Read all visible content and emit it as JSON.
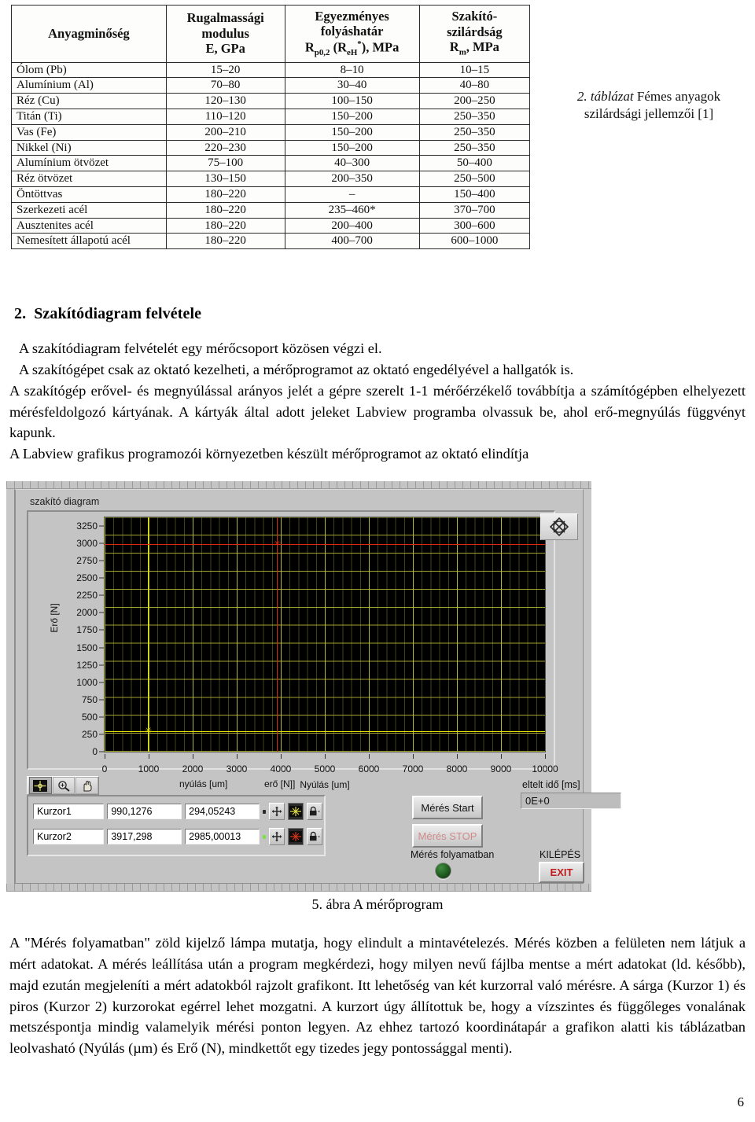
{
  "table": {
    "caption_prefix": "2. táblázat",
    "caption_rest": " Fémes anyagok",
    "caption_line2": "szilárdsági jellemzői [1]",
    "headers": [
      {
        "line1": "Anyagminőség",
        "line2": "",
        "line3": ""
      },
      {
        "line1": "Rugalmassági",
        "line2": "modulus",
        "line3": "E, GPa"
      },
      {
        "line1": "Egyezményes",
        "line2": "folyáshatár",
        "line3": "Rp0,2 (ReH*), MPa"
      },
      {
        "line1": "Szakító-",
        "line2": "szilárdság",
        "line3": "Rm, MPa"
      }
    ],
    "rows": [
      {
        "material": "Ólom (Pb)",
        "e": "15–20",
        "rp": "8–10",
        "rm": "10–15"
      },
      {
        "material": "Alumínium (Al)",
        "e": "70–80",
        "rp": "30–40",
        "rm": "40–80"
      },
      {
        "material": "Réz (Cu)",
        "e": "120–130",
        "rp": "100–150",
        "rm": "200–250"
      },
      {
        "material": "Titán (Ti)",
        "e": "110–120",
        "rp": "150–200",
        "rm": "250–350"
      },
      {
        "material": "Vas (Fe)",
        "e": "200–210",
        "rp": "150–200",
        "rm": "250–350"
      },
      {
        "material": "Nikkel (Ni)",
        "e": "220–230",
        "rp": "150–200",
        "rm": "250–350"
      },
      {
        "material": "Alumínium ötvözet",
        "e": "75–100",
        "rp": "40–300",
        "rm": "50–400"
      },
      {
        "material": "Réz ötvözet",
        "e": "130–150",
        "rp": "200–350",
        "rm": "250–500"
      },
      {
        "material": "Öntöttvas",
        "e": "180–220",
        "rp": "–",
        "rm": "150–400"
      },
      {
        "material": "Szerkezeti acél",
        "e": "180–220",
        "rp": "235–460*",
        "rm": "370–700"
      },
      {
        "material": "Ausztenites acél",
        "e": "180–220",
        "rp": "200–400",
        "rm": "300–600"
      },
      {
        "material": "Nemesített állapotú acél",
        "e": "180–220",
        "rp": "400–700",
        "rm": "600–1000"
      }
    ]
  },
  "section": {
    "number": "2.",
    "title": "Szakítódiagram felvétele",
    "paragraphs": [
      "A szakítódiagram felvételét egy mérőcsoport közösen végzi el.",
      "A szakítógépet csak az oktató kezelheti, a mérőprogramot az oktató engedélyével a hallgatók is.",
      "A szakítógép erővel- és megnyúlással arányos jelét a gépre szerelt 1-1 mérőérzékelő továbbítja a számítógépben elhelyezett mérésfeldolgozó kártyának. A kártyák által adott jeleket Labview programba olvassuk be, ahol erő-megnyúlás függvényt kapunk.",
      "A Labview grafikus programozói környezetben készült mérőprogramot az oktató elindítja"
    ]
  },
  "labview": {
    "graph_title": "szakító diagram",
    "palette_icon": "plot-palette-icon",
    "toolbar": [
      {
        "name": "cursor-move-tool",
        "glyph": "crosshair",
        "active": true
      },
      {
        "name": "zoom-tool",
        "glyph": "magnifier",
        "active": false
      },
      {
        "name": "pan-tool",
        "glyph": "hand",
        "active": false
      }
    ],
    "col_header_x": "nyúlás [um]",
    "col_header_y": "erő [N]]",
    "cursors": [
      {
        "name": "Kurzor1",
        "x": "990,1276",
        "y": "294,05243",
        "color": "#e6e600",
        "led": "#2a2a2a"
      },
      {
        "name": "Kurzor2",
        "x": "3917,298",
        "y": "2985,00013",
        "color": "#d92b12",
        "led": "#79e34a"
      }
    ],
    "start_button": "Mérés Start",
    "stop_button": "Mérés STOP",
    "running_label": "Mérés folyamatban",
    "elapsed_label": "eltelt idő [ms]",
    "elapsed_value": "0E+0",
    "exit_label": "KILÉPÉS",
    "exit_button": "EXIT",
    "colors": {
      "panel": "#c4c4c4",
      "plot_bg": "#000000",
      "grid": "#c9c93c",
      "cursor1": "#e6e600",
      "cursor2": "#d92b12",
      "exit_text": "#c01b1b",
      "led_green": "#2f7a2f"
    }
  },
  "chart_data": {
    "type": "line",
    "title": "szakító diagram",
    "xlabel": "Nyúlás  [um]",
    "ylabel": "Erő [N]",
    "xlim": [
      0,
      10000
    ],
    "ylim": [
      0,
      3375
    ],
    "xticks": [
      0,
      1000,
      2000,
      3000,
      4000,
      5000,
      6000,
      7000,
      8000,
      9000,
      10000
    ],
    "yticks": [
      0,
      250,
      500,
      750,
      1000,
      1250,
      1500,
      1750,
      2000,
      2250,
      2500,
      2750,
      3000,
      3250
    ],
    "grid": true,
    "legend": "none",
    "series": [],
    "cursors": [
      {
        "label": "Kurzor1",
        "x": 990.1276,
        "y": 294.05243,
        "color": "#e6e600"
      },
      {
        "label": "Kurzor2",
        "x": 3917.298,
        "y": 2985.00013,
        "color": "#d92b12"
      }
    ]
  },
  "figure": {
    "caption": "5. ábra A mérőprogram"
  },
  "closing": {
    "paragraph": "A \"Mérés folyamatban\" zöld kijelző lámpa mutatja, hogy elindult a mintavételezés. Mérés közben a felületen nem látjuk a mért adatokat. A mérés leállítása után a program megkérdezi, hogy milyen nevű fájlba mentse a mért adatokat (ld. később), majd ezután megjeleníti a mért adatokból rajzolt grafikont. Itt lehetőség van két kurzorral való mérésre. A sárga (Kurzor 1) és piros (Kurzor 2) kurzorokat egérrel lehet mozgatni. A kurzort úgy állítottuk be, hogy a vízszintes és függőleges vonalának metszéspontja mindig valamelyik mérési ponton legyen. Az ehhez tartozó koordinátapár a grafikon alatti kis táblázatban leolvasható (Nyúlás (µm) és Erő (N), mindkettőt egy tizedes jegy pontossággal menti)."
  },
  "page_number": "6"
}
